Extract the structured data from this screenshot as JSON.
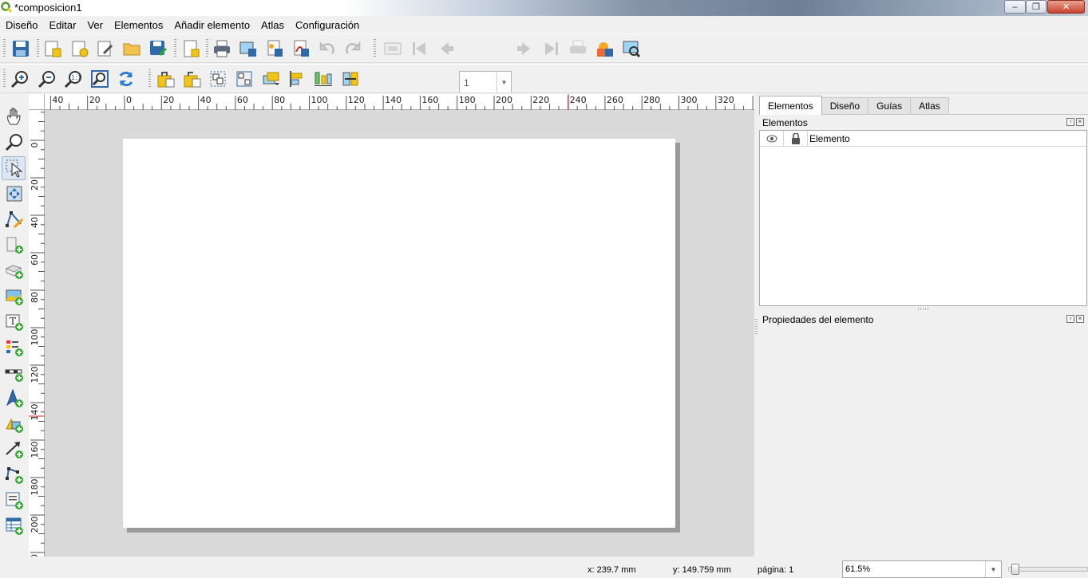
{
  "window": {
    "title": "*composicion1",
    "min_label": "‒",
    "max_label": "❐",
    "close_label": "✕"
  },
  "menubar": [
    "Diseño",
    "Editar",
    "Ver",
    "Elementos",
    "Añadir elemento",
    "Atlas",
    "Configuración"
  ],
  "toolbar": {
    "page_spin_value": "1"
  },
  "rulers": {
    "horizontal_ticks": [
      "40",
      "20",
      "0",
      "20",
      "40",
      "60",
      "80",
      "100",
      "120",
      "140",
      "160",
      "180",
      "200",
      "220",
      "240",
      "260",
      "280",
      "300",
      "320"
    ],
    "vertical_ticks": [
      "0",
      "20",
      "40",
      "60",
      "80",
      "100",
      "120",
      "140",
      "160",
      "180",
      "200",
      "20"
    ]
  },
  "dock": {
    "tabs": [
      "Elementos",
      "Diseño",
      "Guías",
      "Atlas"
    ],
    "active_tab": 0,
    "items_panel_title": "Elementos",
    "items_column_header": "Elemento",
    "properties_panel_title": "Propiedades del elemento"
  },
  "status": {
    "x": "x: 239.7 mm",
    "y": "y: 149.759 mm",
    "page": "página: 1",
    "zoom": "61.5%"
  },
  "colors": {
    "accent_qgis": "#589632",
    "page": "#ffffff",
    "canvas": "#d9d9d9",
    "close_button": "#c7432b"
  }
}
